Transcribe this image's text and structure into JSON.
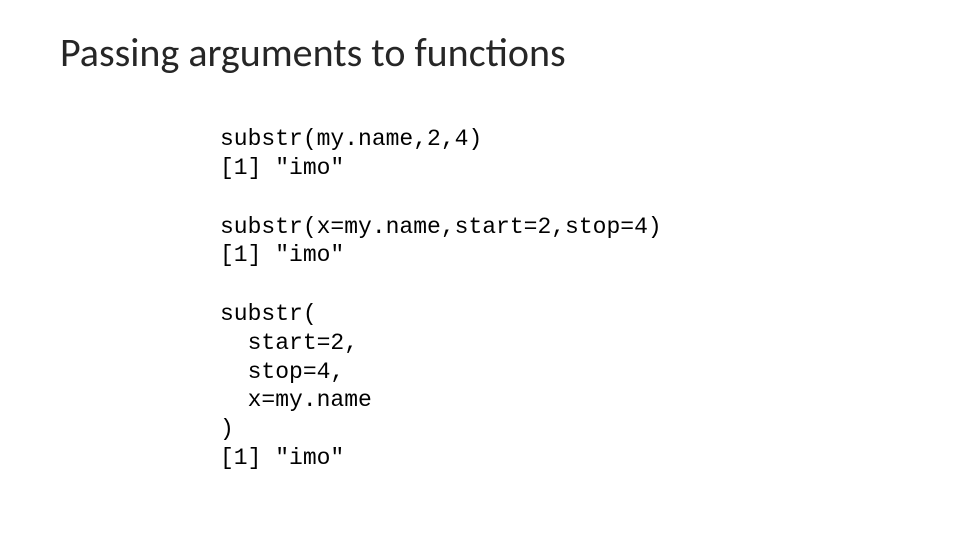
{
  "slide": {
    "title": "Passing arguments to functions",
    "blocks": [
      "substr(my.name,2,4)\n[1] \"imo\"",
      "substr(x=my.name,start=2,stop=4)\n[1] \"imo\"",
      "substr(\n  start=2,\n  stop=4,\n  x=my.name\n)\n[1] \"imo\""
    ]
  }
}
